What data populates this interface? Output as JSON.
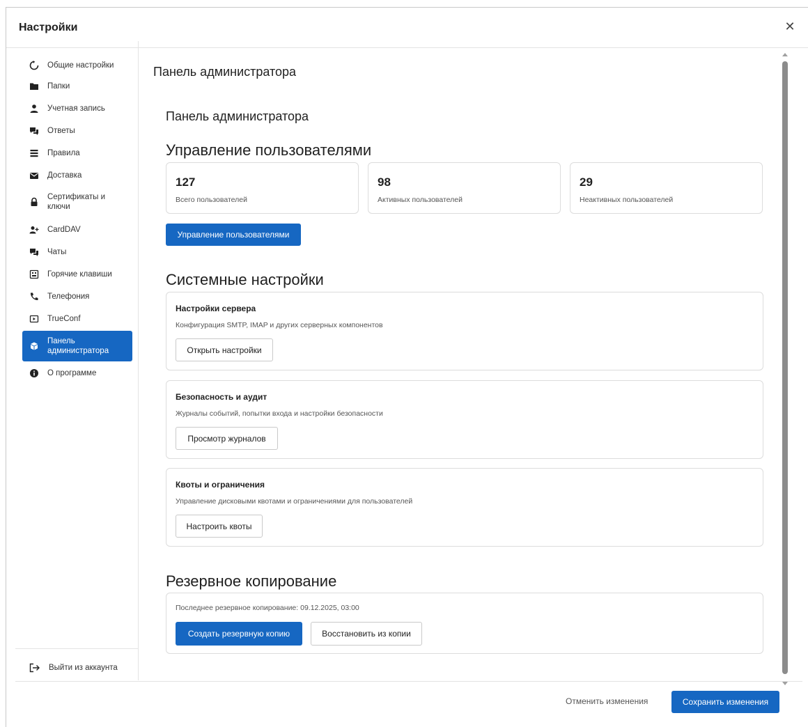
{
  "window": {
    "title": "Настройки"
  },
  "sidebar": {
    "items": [
      {
        "label": "Общие настройки",
        "icon": "general-settings-icon"
      },
      {
        "label": "Папки",
        "icon": "folder-icon"
      },
      {
        "label": "Учетная запись",
        "icon": "account-icon"
      },
      {
        "label": "Ответы",
        "icon": "replies-icon"
      },
      {
        "label": "Правила",
        "icon": "rules-icon"
      },
      {
        "label": "Доставка",
        "icon": "envelope-icon"
      },
      {
        "label": "Сертификаты и ключи",
        "icon": "lock-icon"
      },
      {
        "label": "CardDAV",
        "icon": "add-user-icon"
      },
      {
        "label": "Чаты",
        "icon": "chat-icon"
      },
      {
        "label": "Горячие клавиши",
        "icon": "keyboard-icon"
      },
      {
        "label": "Телефония",
        "icon": "phone-icon"
      },
      {
        "label": "TrueConf",
        "icon": "video-icon"
      },
      {
        "label": "Панель администратора",
        "icon": "admin-box-icon"
      },
      {
        "label": "О программе",
        "icon": "info-icon"
      }
    ],
    "active_index": 12,
    "logout_label": "Выйти из аккаунта"
  },
  "main": {
    "page_title": "Панель администратора",
    "sub_title": "Панель администратора",
    "users": {
      "heading": "Управление пользователями",
      "stats": [
        {
          "value": "127",
          "label": "Всего пользователей"
        },
        {
          "value": "98",
          "label": "Активных пользователей"
        },
        {
          "value": "29",
          "label": "Неактивных пользователей"
        }
      ],
      "button": "Управление пользователями"
    },
    "system": {
      "heading": "Системные настройки",
      "cards": [
        {
          "title": "Настройки сервера",
          "desc": "Конфигурация SMTP, IMAP и других серверных компонентов",
          "button": "Открыть настройки"
        },
        {
          "title": "Безопасность и аудит",
          "desc": "Журналы событий, попытки входа и настройки безопасности",
          "button": "Просмотр журналов"
        },
        {
          "title": "Квоты и ограничения",
          "desc": "Управление дисковыми квотами и ограничениями для пользователей",
          "button": "Настроить квоты"
        }
      ]
    },
    "backup": {
      "heading": "Резервное копирование",
      "last": "Последнее резервное копирование: 09.12.2025, 03:00",
      "create": "Создать резервную копию",
      "restore": "Восстановить из копии"
    }
  },
  "footer": {
    "cancel": "Отменить изменения",
    "save": "Сохранить изменения"
  },
  "colors": {
    "accent": "#1667c2",
    "border": "#dcdcdc"
  }
}
